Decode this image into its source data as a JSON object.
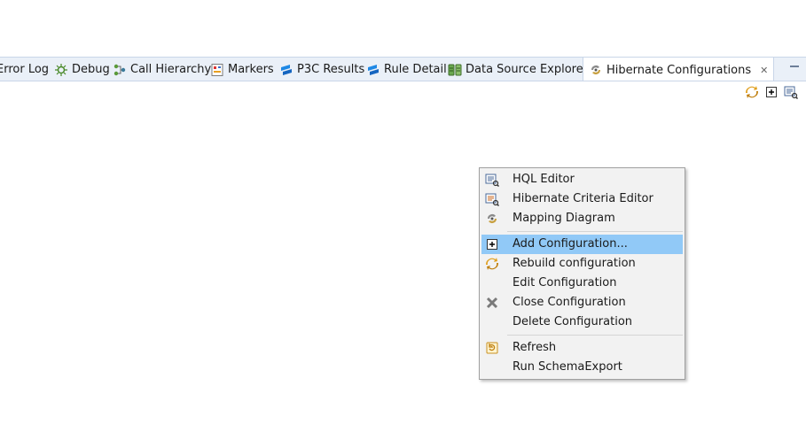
{
  "tabs": [
    {
      "label": "Error Log",
      "icon": "error-log-icon"
    },
    {
      "label": "Debug",
      "icon": "debug-icon"
    },
    {
      "label": "Call Hierarchy",
      "icon": "call-hierarchy-icon"
    },
    {
      "label": "Markers",
      "icon": "markers-icon"
    },
    {
      "label": "P3C Results",
      "icon": "p3c-icon"
    },
    {
      "label": "Rule Detail",
      "icon": "rule-detail-icon"
    },
    {
      "label": "Data Source Explorer",
      "icon": "data-source-icon"
    },
    {
      "label": "Hibernate Configurations",
      "icon": "hibernate-icon",
      "close": "✕"
    }
  ],
  "menu": {
    "items": [
      {
        "label": "HQL Editor",
        "icon": "hql-editor-icon"
      },
      {
        "label": "Hibernate Criteria Editor",
        "icon": "criteria-editor-icon"
      },
      {
        "label": "Mapping Diagram",
        "icon": "mapping-diagram-icon"
      },
      {
        "label": "Add Configuration...",
        "icon": "add-icon"
      },
      {
        "label": "Rebuild configuration",
        "icon": "rebuild-icon"
      },
      {
        "label": "Edit Configuration",
        "icon": ""
      },
      {
        "label": "Close Configuration",
        "icon": "close-x-icon"
      },
      {
        "label": "Delete Configuration",
        "icon": ""
      },
      {
        "label": "Refresh",
        "icon": "refresh-icon"
      },
      {
        "label": "Run SchemaExport",
        "icon": ""
      }
    ]
  },
  "colors": {
    "tabbar_bg": "#eaf0f8",
    "highlight": "#91c9f7",
    "menu_bg": "#f2f2f2",
    "p3c_blue": "#1e88e5",
    "hibernate_brown": "#c8a040"
  }
}
